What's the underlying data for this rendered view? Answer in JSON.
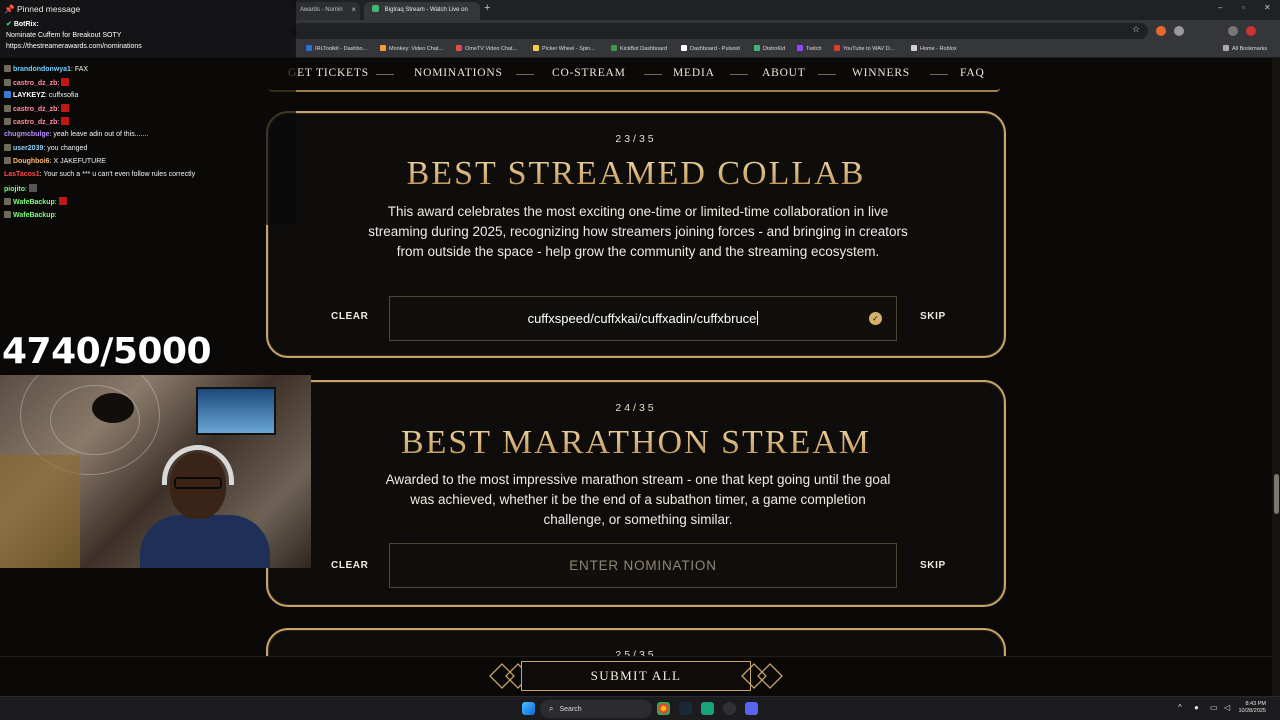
{
  "browser": {
    "tabs": [
      {
        "label": "Awards - Nomin"
      },
      {
        "label": "BigIraq Stream - Watch Live on"
      }
    ],
    "bookmarks": [
      {
        "label": "IRLToolkit - Dashbo...",
        "color": "#2f6cd6"
      },
      {
        "label": "Monkey: Video Chat...",
        "color": "#f0a030"
      },
      {
        "label": "OmeTV Video Chat...",
        "color": "#e05050"
      },
      {
        "label": "Picker Wheel - Spin...",
        "color": "#f2d046"
      },
      {
        "label": "KickBot Dashboard",
        "color": "#3a9a46"
      },
      {
        "label": "Dashboard - Pulsoid",
        "color": "#ffffff"
      },
      {
        "label": "DistroKid",
        "color": "#3fb96f"
      },
      {
        "label": "Twitch",
        "color": "#9146ff"
      },
      {
        "label": "YouTube to WAV D...",
        "color": "#e53935"
      },
      {
        "label": "Home - Roblox",
        "color": "#d0d0d0"
      }
    ],
    "all_bookmarks": "All Bookmarks"
  },
  "nav": {
    "items": [
      "GET TICKETS",
      "NOMINATIONS",
      "CO-STREAM",
      "MEDIA",
      "ABOUT",
      "WINNERS",
      "FAQ"
    ]
  },
  "categories": [
    {
      "counter": "23/35",
      "title": "BEST STREAMED COLLAB",
      "description": "This award celebrates the most exciting one-time or limited-time collaboration in live streaming during 2025, recognizing how streamers joining forces - and bringing in creators from outside the space - help grow the community and the streaming ecosystem.",
      "clear": "CLEAR",
      "skip": "SKIP",
      "value": "cuffxspeed/cuffxkai/cuffxadin/cuffxbruce",
      "placeholder": ""
    },
    {
      "counter": "24/35",
      "title": "BEST MARATHON STREAM",
      "description": "Awarded to the most impressive marathon stream - one that kept going until the goal was achieved, whether it be the end of a subathon timer, a game completion challenge, or something similar.",
      "clear": "CLEAR",
      "skip": "SKIP",
      "value": "",
      "placeholder": "ENTER NOMINATION"
    },
    {
      "counter": "25/35"
    }
  ],
  "submit": "SUBMIT ALL",
  "chat": {
    "pinned_header": "Pinned message",
    "pinned_user": "BotRix:",
    "pinned_line1": "Nominate Cuffem for Breakout SOTY",
    "pinned_line2": "https://thestreamerawards.com/nominations",
    "messages": [
      {
        "user": "brandondonwya1",
        "color": "#6fd0ff",
        "text": "FAX"
      },
      {
        "user": "castro_dz_zb",
        "color": "#ff8fa0",
        "text": ""
      },
      {
        "user": "LAYKEYZ",
        "color": "#ffffff",
        "text": "cuffxsofia"
      },
      {
        "user": "castro_dz_zb",
        "color": "#ff8fa0",
        "text": ""
      },
      {
        "user": "castro_dz_zb",
        "color": "#ff8fa0",
        "text": ""
      },
      {
        "user": "chugmcbulge",
        "color": "#b58cff",
        "text": "yeah leave adin out of this......."
      },
      {
        "user": "user2039",
        "color": "#8fd4ff",
        "text": "you changed"
      },
      {
        "user": "Doughboi6",
        "color": "#ffb86c",
        "text": "X JAKEFUTURE"
      },
      {
        "user": "LasTacos1",
        "color": "#ff4b4b",
        "text": "Your such a *** u can't even follow rules correctly"
      },
      {
        "user": "piojito",
        "color": "#7dff7d",
        "text": ""
      },
      {
        "user": "WafeBackup",
        "color": "#7dff7d",
        "text": ""
      },
      {
        "user": "WafeBackup",
        "color": "#7dff7d",
        "text": ""
      }
    ]
  },
  "overlay": {
    "goal": "4740/5000"
  },
  "taskbar": {
    "search": "Search",
    "time": "8:43 PM",
    "date": "10/28/2025"
  },
  "colors": {
    "gold": "#c8a468",
    "accent": "#d9b67a"
  }
}
